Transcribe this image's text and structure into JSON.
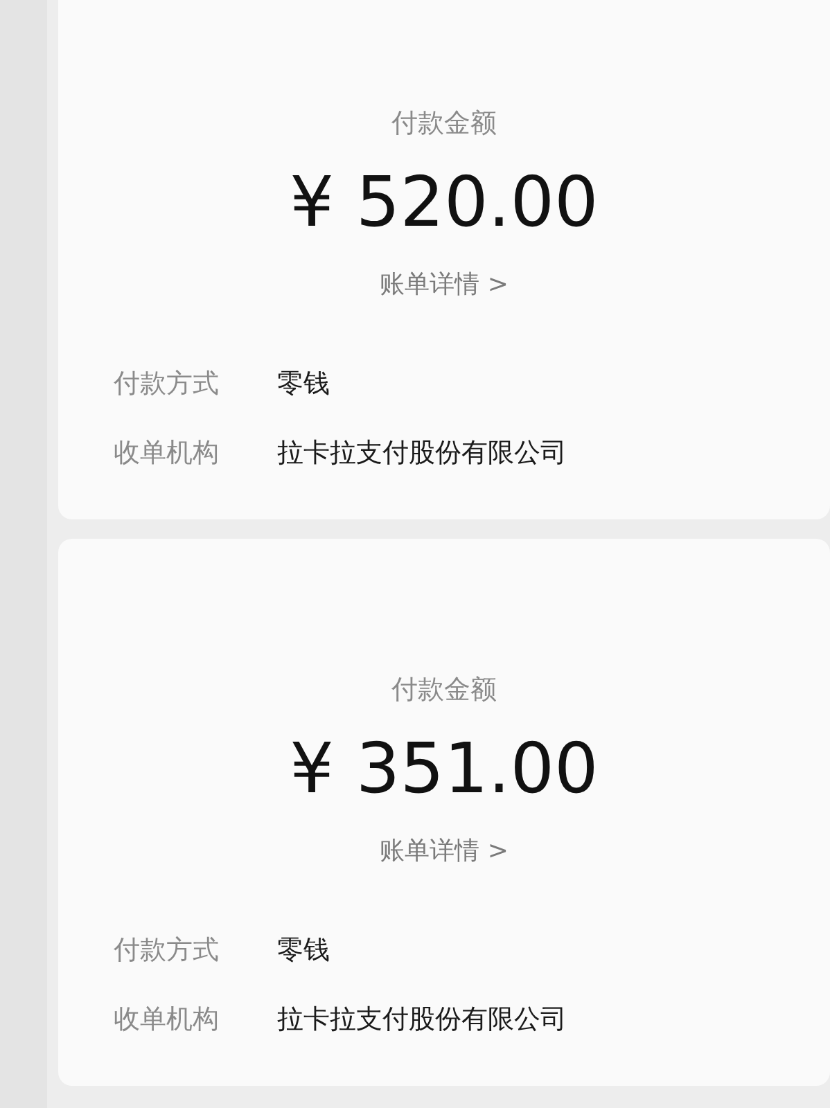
{
  "payments": [
    {
      "amount_label": "付款金额",
      "amount": "¥ 520.00",
      "details_link": "账单详情 >",
      "fields": [
        {
          "label": "付款方式",
          "value": "零钱"
        },
        {
          "label": "收单机构",
          "value": "拉卡拉支付股份有限公司"
        }
      ]
    },
    {
      "amount_label": "付款金额",
      "amount": "¥ 351.00",
      "details_link": "账单详情 >",
      "fields": [
        {
          "label": "付款方式",
          "value": "零钱"
        },
        {
          "label": "收单机构",
          "value": "拉卡拉支付股份有限公司"
        }
      ]
    }
  ]
}
